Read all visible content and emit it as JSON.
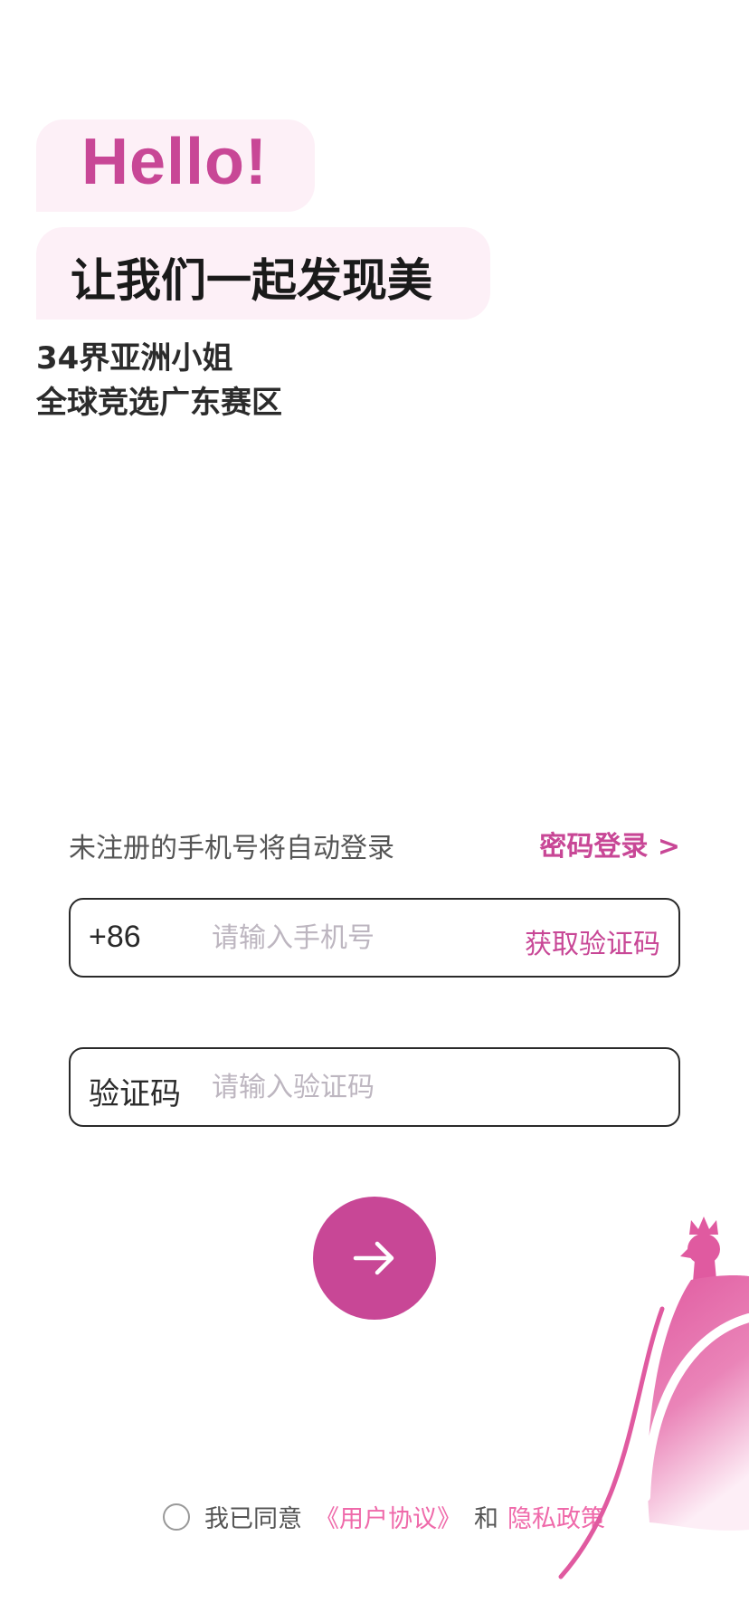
{
  "header": {
    "greeting": "Hello!",
    "tagline": "让我们一起发现美",
    "subtitle_line1": "34界亚洲小姐",
    "subtitle_line2": "全球竞选广东赛区"
  },
  "login": {
    "hint": "未注册的手机号将自动登录",
    "password_login_label": "密码登录 >",
    "phone": {
      "prefix": "+86",
      "placeholder": "请输入手机号",
      "value": "",
      "get_code_label": "获取验证码"
    },
    "code": {
      "label": "验证码",
      "placeholder": "请输入验证码",
      "value": ""
    },
    "submit_icon": "arrow-right-icon"
  },
  "agreement": {
    "checked": false,
    "prefix": "我已同意",
    "user_agreement": "《用户协议》",
    "and": "和",
    "privacy_policy": "隐私政策"
  },
  "colors": {
    "accent": "#c84796",
    "link": "#ef6aaa",
    "bubble": "#fdf0f7",
    "text_dark": "#1a1a1a",
    "placeholder": "#bdb6c0"
  }
}
